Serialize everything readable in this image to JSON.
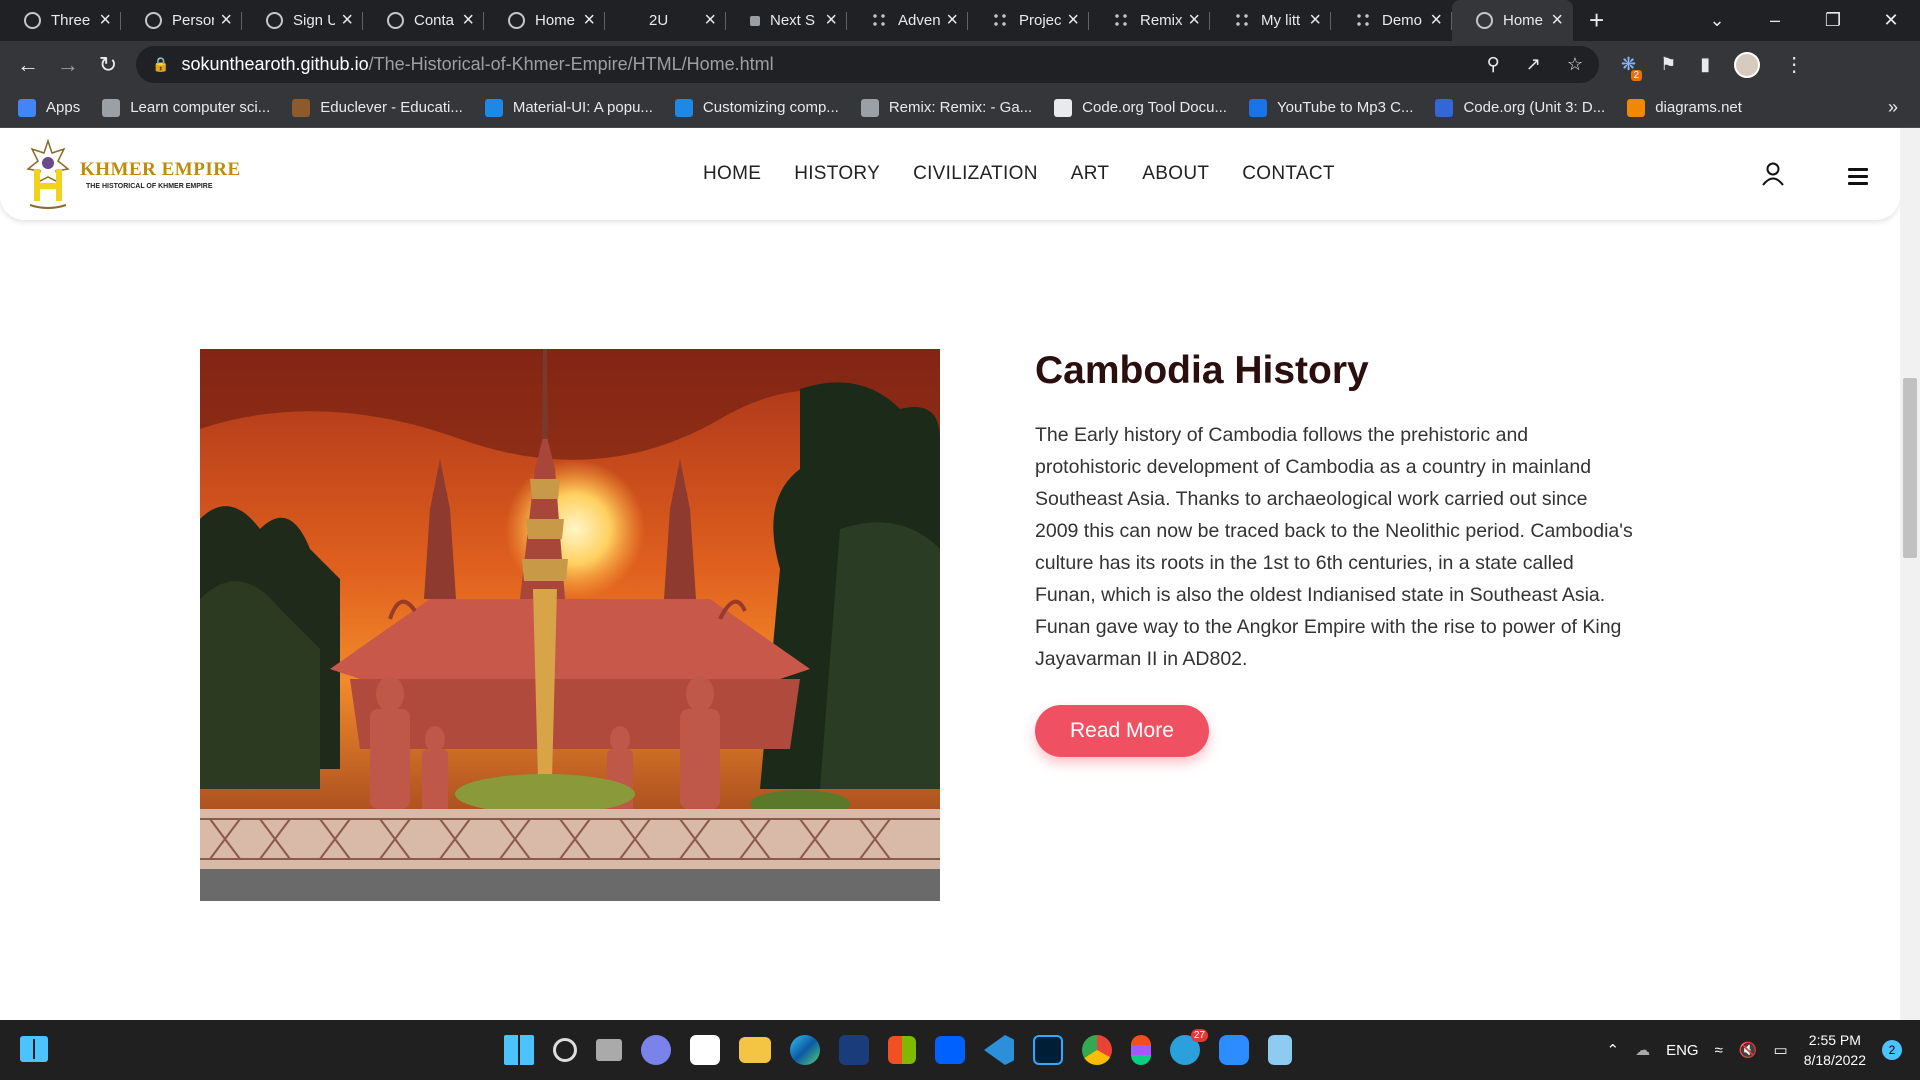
{
  "browser": {
    "tabs": [
      {
        "label": "Three",
        "icon": "globe-icon"
      },
      {
        "label": "Persor",
        "icon": "globe-icon"
      },
      {
        "label": "Sign U",
        "icon": "globe-icon"
      },
      {
        "label": "Conta",
        "icon": "globe-icon"
      },
      {
        "label": "Home",
        "icon": "globe-icon"
      },
      {
        "label": "2U",
        "icon": "blank-icon"
      },
      {
        "label": "Next S",
        "icon": "page-icon"
      },
      {
        "label": "Adven",
        "icon": "grid-icon"
      },
      {
        "label": "Projec",
        "icon": "grid-icon"
      },
      {
        "label": "Remix",
        "icon": "grid-icon"
      },
      {
        "label": "My litt",
        "icon": "grid-icon"
      },
      {
        "label": "Demo",
        "icon": "grid-icon"
      },
      {
        "label": "Home",
        "icon": "globe-icon",
        "active": true
      }
    ],
    "url_host": "sokunthearoth.github.io",
    "url_path": "/The-Historical-of-Khmer-Empire/HTML/Home.html",
    "extension_badge": "2",
    "bookmarks": [
      {
        "label": "Apps",
        "color": "#4285f4"
      },
      {
        "label": "Learn computer sci...",
        "color": "#9aa0a6"
      },
      {
        "label": "Educlever - Educati...",
        "color": "#8d5a2b"
      },
      {
        "label": "Material-UI: A popu...",
        "color": "#1e88e5"
      },
      {
        "label": "Customizing comp...",
        "color": "#1e88e5"
      },
      {
        "label": "Remix: Remix: - Ga...",
        "color": "#9aa0a6"
      },
      {
        "label": "Code.org Tool Docu...",
        "color": "#e8eaed"
      },
      {
        "label": "YouTube to Mp3 C...",
        "color": "#1a73e8"
      },
      {
        "label": "Code.org (Unit 3: D...",
        "color": "#3367d6"
      },
      {
        "label": "diagrams.net",
        "color": "#f08705"
      }
    ]
  },
  "site": {
    "logo_title": "KHMER EMPIRE",
    "logo_subtitle": "THE HISTORICAL OF KHMER EMPIRE",
    "nav": [
      "HOME",
      "HISTORY",
      "CIVILIZATION",
      "ART",
      "ABOUT",
      "CONTACT"
    ],
    "heading": "Cambodia History",
    "body": "The Early history of Cambodia follows the prehistoric and protohistoric development of Cambodia as a country in mainland Southeast Asia. Thanks to archaeological work carried out since 2009 this can now be traced back to the Neolithic period. Cambodia's culture has its roots in the 1st to 6th centuries, in a state called Funan, which is also the oldest Indianised state in Southeast Asia. Funan gave way to the Angkor Empire with the rise to power of King Jayavarman II in AD802.",
    "cta": "Read More"
  },
  "taskbar": {
    "language": "ENG",
    "time": "2:55 PM",
    "date": "8/18/2022",
    "notifications": "2",
    "telegram_badge": "27"
  }
}
